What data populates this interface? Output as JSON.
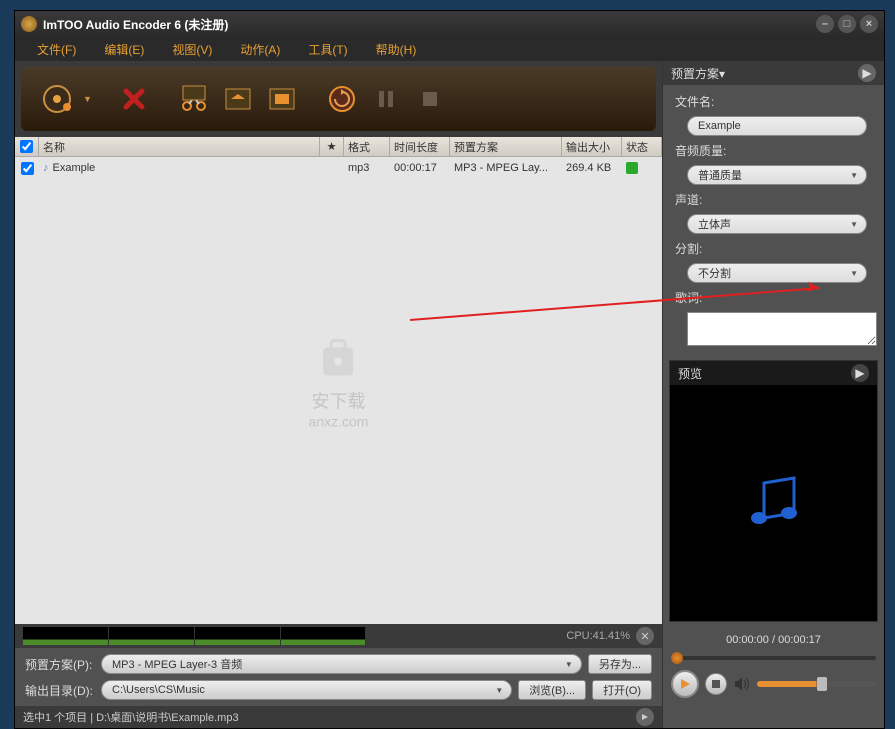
{
  "window": {
    "title": "ImTOO Audio Encoder 6 (未注册)"
  },
  "menu": {
    "file": "文件(F)",
    "edit": "编辑(E)",
    "view": "视图(V)",
    "action": "动作(A)",
    "tools": "工具(T)",
    "help": "帮助(H)"
  },
  "listheader": {
    "name": "名称",
    "star": "★",
    "format": "格式",
    "duration": "时间长度",
    "profile": "预置方案",
    "size": "输出大小",
    "status": "状态"
  },
  "file_item": {
    "name": "Example",
    "format": "mp3",
    "duration": "00:00:17",
    "profile": "MP3 - MPEG Lay...",
    "size": "269.4 KB"
  },
  "watermark": {
    "text1": "安下载",
    "text2": "anxz.com"
  },
  "cpu": {
    "label": "CPU:41.41%"
  },
  "bottom": {
    "profile_label": "预置方案(P):",
    "profile_value": "MP3 - MPEG Layer-3 音频",
    "saveas": "另存为...",
    "output_label": "输出目录(D):",
    "output_value": "C:\\Users\\CS\\Music",
    "browse": "浏览(B)...",
    "open": "打开(O)"
  },
  "status": {
    "text": "选中1 个项目 | D:\\桌面\\说明书\\Example.mp3"
  },
  "side": {
    "header": "预置方案▾",
    "filename_label": "文件名:",
    "filename_value": "Example",
    "quality_label": "音频质量:",
    "quality_value": "普通质量",
    "channel_label": "声道:",
    "channel_value": "立体声",
    "split_label": "分割:",
    "split_value": "不分割",
    "lyrics_label": "歌词:"
  },
  "preview": {
    "header": "预览",
    "time": "00:00:00 / 00:00:17"
  }
}
